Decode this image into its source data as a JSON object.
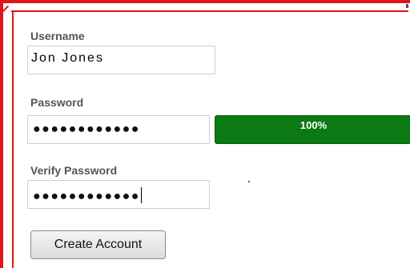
{
  "form": {
    "username_label": "Username",
    "username_value": "Jon Jones",
    "password_label": "Password",
    "password_mask": "●●●●●●●●●●●●",
    "strength_value": 1.0,
    "strength_text": "100%",
    "verify_label": "Verify Password",
    "verify_mask": "●●●●●●●●●●●●",
    "submit_label": "Create Account"
  },
  "colors": {
    "highlight_border": "#e0141b",
    "strength_fill": "#0c7a12"
  }
}
